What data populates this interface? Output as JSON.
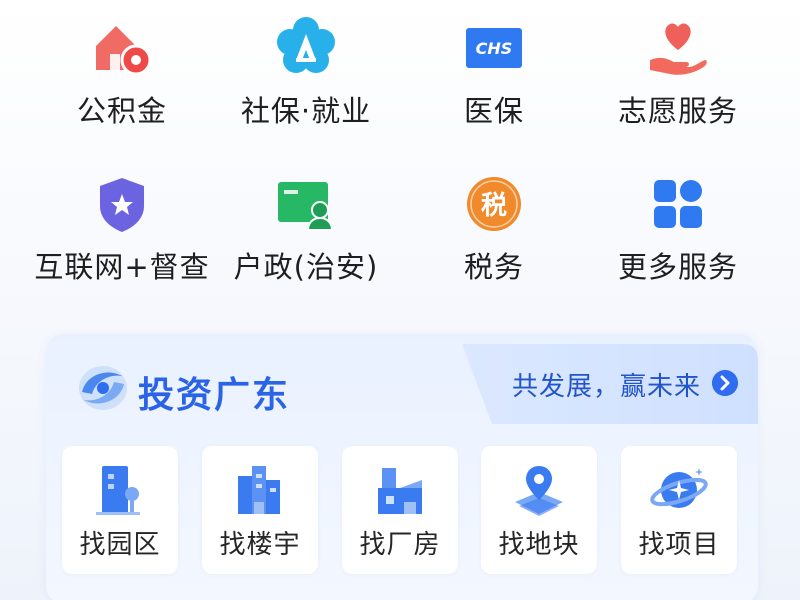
{
  "services": [
    {
      "label": "公积金",
      "icon": "house-coin-icon"
    },
    {
      "label": "社保·就业",
      "icon": "social-security-flower-icon"
    },
    {
      "label": "医保",
      "icon": "chs-card-icon"
    },
    {
      "label": "志愿服务",
      "icon": "heart-hand-icon"
    },
    {
      "label": "互联网+督查",
      "icon": "star-shield-icon"
    },
    {
      "label": "户政(治安)",
      "icon": "id-card-person-icon"
    },
    {
      "label": "税务",
      "icon": "tax-circle-icon"
    },
    {
      "label": "更多服务",
      "icon": "grid-apps-icon"
    }
  ],
  "chs_badge": "CHS",
  "tax_glyph": "税",
  "invest": {
    "title": "投资广东",
    "slogan": "共发展，赢未来",
    "tiles": [
      {
        "label": "找园区",
        "icon": "park-building-icon"
      },
      {
        "label": "找楼宇",
        "icon": "office-towers-icon"
      },
      {
        "label": "找厂房",
        "icon": "factory-icon"
      },
      {
        "label": "找地块",
        "icon": "land-pin-icon"
      },
      {
        "label": "找项目",
        "icon": "planet-project-icon"
      }
    ]
  },
  "colors": {
    "accent_blue": "#2f6cf0",
    "title_blue": "#2a63e6",
    "coral": "#f0605a",
    "teal": "#2aa5e8",
    "green": "#25b765",
    "purple": "#6c63e0",
    "orange": "#f08a2a"
  }
}
